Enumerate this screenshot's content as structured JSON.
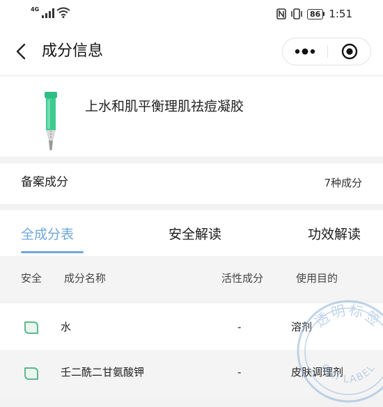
{
  "status_bar": {
    "network": "4G",
    "battery": "86",
    "time": "1:51"
  },
  "nav": {
    "title": "成分信息"
  },
  "product": {
    "name": "上水和肌平衡理肌祛痘凝胶"
  },
  "record": {
    "label": "备案成分",
    "count": "7种成分"
  },
  "tabs": [
    {
      "label": "全成分表",
      "active": true
    },
    {
      "label": "安全解读",
      "active": false
    },
    {
      "label": "功效解读",
      "active": false
    }
  ],
  "table": {
    "headers": {
      "safety": "安全",
      "name": "成分名称",
      "active": "活性成分",
      "purpose": "使用目的"
    },
    "rows": [
      {
        "name": "水",
        "active": "-",
        "purpose": "溶剂"
      },
      {
        "name": "壬二酰二甘氨酸钾",
        "active": "-",
        "purpose": "皮肤调理剂"
      }
    ]
  },
  "watermark": {
    "line1": "透明标签",
    "line2": "OMI LABEL"
  },
  "colors": {
    "accent": "#6ea7da",
    "safe_leaf": "#5cb88f",
    "product_green": "#35c58a"
  }
}
